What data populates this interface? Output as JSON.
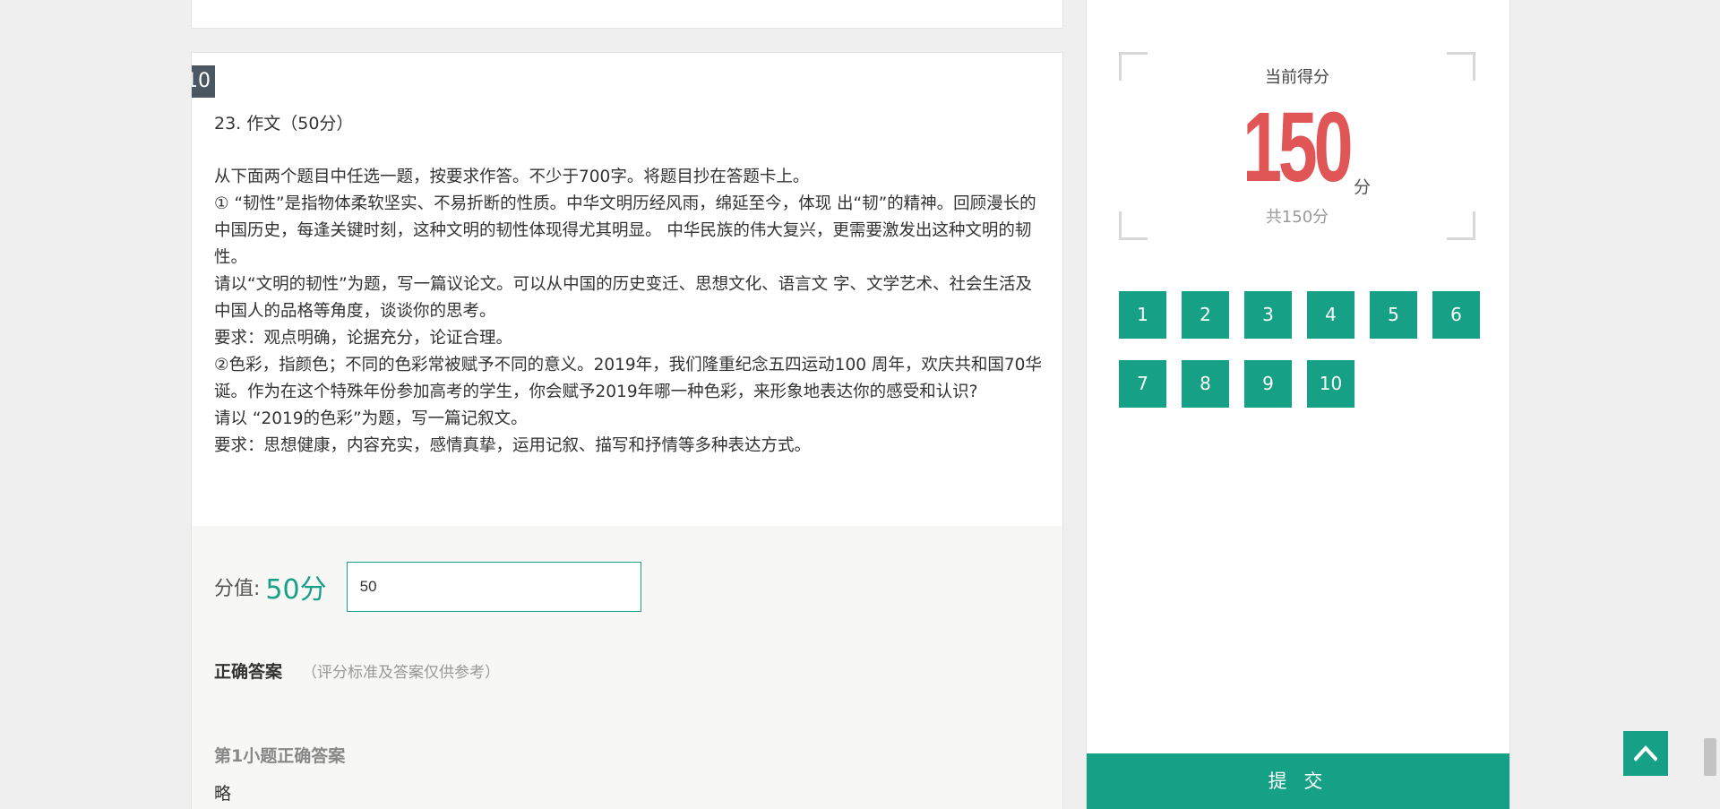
{
  "question": {
    "badge": "10",
    "title": "23.  作文（50分）",
    "body": [
      "从下面两个题目中任选一题，按要求作答。不少于700字。将题目抄在答题卡上。",
      "①  “韧性”是指物体柔软坚实、不易折断的性质。中华文明历经风雨，绵延至今，体现 出“韧”的精神。回顾漫长的中国历史，每逢关键时刻，这种文明的韧性体现得尤其明显。 中华民族的伟大复兴，更需要激发出这种文明的韧性。",
      "请以“文明的韧性”为题，写一篇议论文。可以从中国的历史变迁、思想文化、语言文 字、文学艺术、社会生活及中国人的品格等角度，谈谈你的思考。",
      "要求：观点明确，论据充分，论证合理。",
      "②色彩，指颜色；不同的色彩常被赋予不同的意义。2019年，我们隆重纪念五四运动100 周年，欢庆共和国70华诞。作为在这个特殊年份参加高考的学生，你会赋予2019年哪一种色彩，来形象地表达你的感受和认识?",
      "请以 “2019的色彩”为题，写一篇记叙文。",
      "要求：思想健康，内容充实，感情真挚，运用记叙、描写和抒情等多种表达方式。"
    ],
    "score_label": "分值:",
    "score_value": "50分",
    "score_input_value": "50",
    "correct_title": "正确答案",
    "correct_note": "（评分标准及答案仅供参考）",
    "sub_title": "第1小题正确答案",
    "sub_answer": "略"
  },
  "sidebar": {
    "score_caption": "当前得分",
    "current_score": "150",
    "score_unit": "分",
    "total_score": "共150分",
    "nav_items": [
      "1",
      "2",
      "3",
      "4",
      "5",
      "6",
      "7",
      "8",
      "9",
      "10"
    ],
    "submit_label": "提 交"
  },
  "colors": {
    "accent": "#16a085",
    "score_red": "#e05555",
    "badge_bg": "#4a5763"
  },
  "icons": {
    "back_to_top": "chevron-up-icon"
  }
}
